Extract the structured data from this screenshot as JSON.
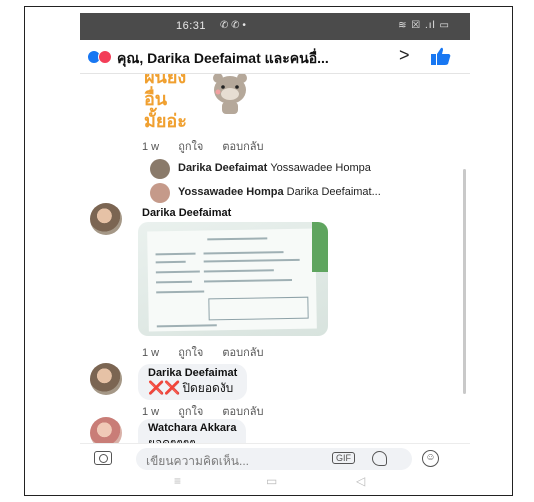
{
  "status_bar": {
    "time": "16:31",
    "notif_icons": "✆ ✆ •",
    "system_icons": "≋ ☒ .ıl ▭"
  },
  "header": {
    "title": "คุณ, Darika Deefaimat และคนอื่...",
    "chevron": ">"
  },
  "sticker": {
    "text": "ฝันยัง\nอื่น\nมั้ยอ่ะ"
  },
  "comments": [
    {
      "time": "1 w",
      "like": "ถูกใจ",
      "reply": "ตอบกลับ"
    }
  ],
  "replies": [
    {
      "name": "Darika Deefaimat",
      "text": "Yossawadee Hompa"
    },
    {
      "name": "Yossawadee Hompa",
      "text": "Darika Deefaimat..."
    }
  ],
  "post": {
    "author": "Darika Deefaimat",
    "time": "1 w",
    "like": "ถูกใจ",
    "reply": "ตอบกลับ"
  },
  "comment2": {
    "name": "Darika Deefaimat",
    "marks": "❌❌",
    "text": "ปิดยอดงับ",
    "time": "1 w",
    "like": "ถูกใจ",
    "reply": "ตอบกลับ"
  },
  "comment3": {
    "name": "Watchara Akkara",
    "text": "ยอดๆๆๆๆ"
  },
  "composer": {
    "placeholder": "เขียนความคิดเห็น...",
    "gif": "GIF",
    "smile": "☺"
  },
  "navbar": {
    "recents": "≡",
    "home": "▭",
    "back": "◁"
  },
  "colors": {
    "accent": "#1877f2",
    "love": "#f33e58",
    "status_bar": "#4b4b4b"
  }
}
